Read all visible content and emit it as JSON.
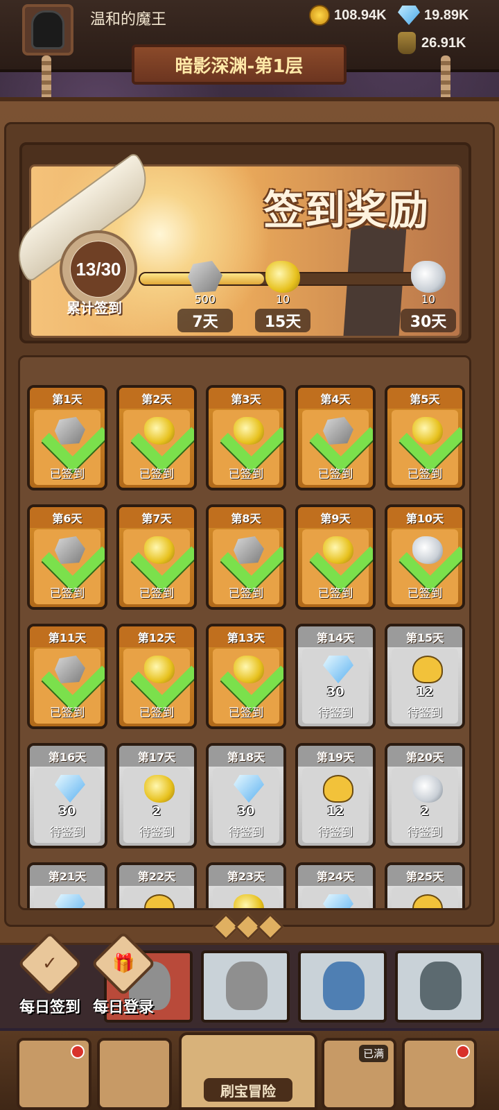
{
  "header": {
    "player_name": "温和的魔王",
    "gold": "108.94K",
    "gems": "19.89K",
    "jars": "26.91K",
    "level_title": "暗影深渊-第1层"
  },
  "signin": {
    "title": "签到奖励",
    "progress_text": "13/30",
    "progress_label": "累计签到",
    "progress_fraction": 0.43,
    "milestones": [
      {
        "qty": "500",
        "day": "7天",
        "icon": "stone-icon"
      },
      {
        "qty": "10",
        "day": "15天",
        "icon": "gold-scroll-icon"
      },
      {
        "qty": "10",
        "day": "30天",
        "icon": "silver-scroll-icon"
      }
    ]
  },
  "days": [
    {
      "day": "第1天",
      "status": "已签到",
      "qty": "",
      "icon": "stone-icon",
      "done": true
    },
    {
      "day": "第2天",
      "status": "已签到",
      "qty": "",
      "icon": "gold-scroll-icon",
      "done": true
    },
    {
      "day": "第3天",
      "status": "已签到",
      "qty": "",
      "icon": "gold-scroll-icon",
      "done": true
    },
    {
      "day": "第4天",
      "status": "已签到",
      "qty": "",
      "icon": "stone-icon",
      "done": true
    },
    {
      "day": "第5天",
      "status": "已签到",
      "qty": "",
      "icon": "gold-scroll-icon",
      "done": true
    },
    {
      "day": "第6天",
      "status": "已签到",
      "qty": "",
      "icon": "stone-icon",
      "done": true
    },
    {
      "day": "第7天",
      "status": "已签到",
      "qty": "",
      "icon": "gold-scroll-icon",
      "done": true
    },
    {
      "day": "第8天",
      "status": "已签到",
      "qty": "",
      "icon": "stone-icon",
      "done": true
    },
    {
      "day": "第9天",
      "status": "已签到",
      "qty": "",
      "icon": "gold-scroll-icon",
      "done": true
    },
    {
      "day": "第10天",
      "status": "已签到",
      "qty": "",
      "icon": "silver-scroll-icon",
      "done": true
    },
    {
      "day": "第11天",
      "status": "已签到",
      "qty": "",
      "icon": "stone-icon",
      "done": true
    },
    {
      "day": "第12天",
      "status": "已签到",
      "qty": "",
      "icon": "gold-scroll-icon",
      "done": true
    },
    {
      "day": "第13天",
      "status": "已签到",
      "qty": "",
      "icon": "gold-scroll-icon",
      "done": true
    },
    {
      "day": "第14天",
      "status": "待签到",
      "qty": "30",
      "icon": "gem-icon",
      "done": false
    },
    {
      "day": "第15天",
      "status": "待签到",
      "qty": "12",
      "icon": "hero-icon",
      "done": false
    },
    {
      "day": "第16天",
      "status": "待签到",
      "qty": "30",
      "icon": "gem-icon",
      "done": false
    },
    {
      "day": "第17天",
      "status": "待签到",
      "qty": "2",
      "icon": "gold-scroll-icon",
      "done": false
    },
    {
      "day": "第18天",
      "status": "待签到",
      "qty": "30",
      "icon": "gem-icon",
      "done": false
    },
    {
      "day": "第19天",
      "status": "待签到",
      "qty": "12",
      "icon": "hero-icon",
      "done": false
    },
    {
      "day": "第20天",
      "status": "待签到",
      "qty": "2",
      "icon": "silver-scroll-icon",
      "done": false
    },
    {
      "day": "第21天",
      "status": "",
      "qty": "",
      "icon": "gem-icon",
      "done": false
    },
    {
      "day": "第22天",
      "status": "",
      "qty": "",
      "icon": "hero-icon",
      "done": false
    },
    {
      "day": "第23天",
      "status": "",
      "qty": "",
      "icon": "gold-scroll-icon",
      "done": false
    },
    {
      "day": "第24天",
      "status": "",
      "qty": "",
      "icon": "gem-icon",
      "done": false
    },
    {
      "day": "第25天",
      "status": "",
      "qty": "",
      "icon": "hero-icon",
      "done": false
    }
  ],
  "side_buttons": {
    "daily_signin": "每日签到",
    "daily_login": "每日登录"
  },
  "bottom_nav": {
    "center_label": "刷宝冒险",
    "full_badge": "已满"
  }
}
